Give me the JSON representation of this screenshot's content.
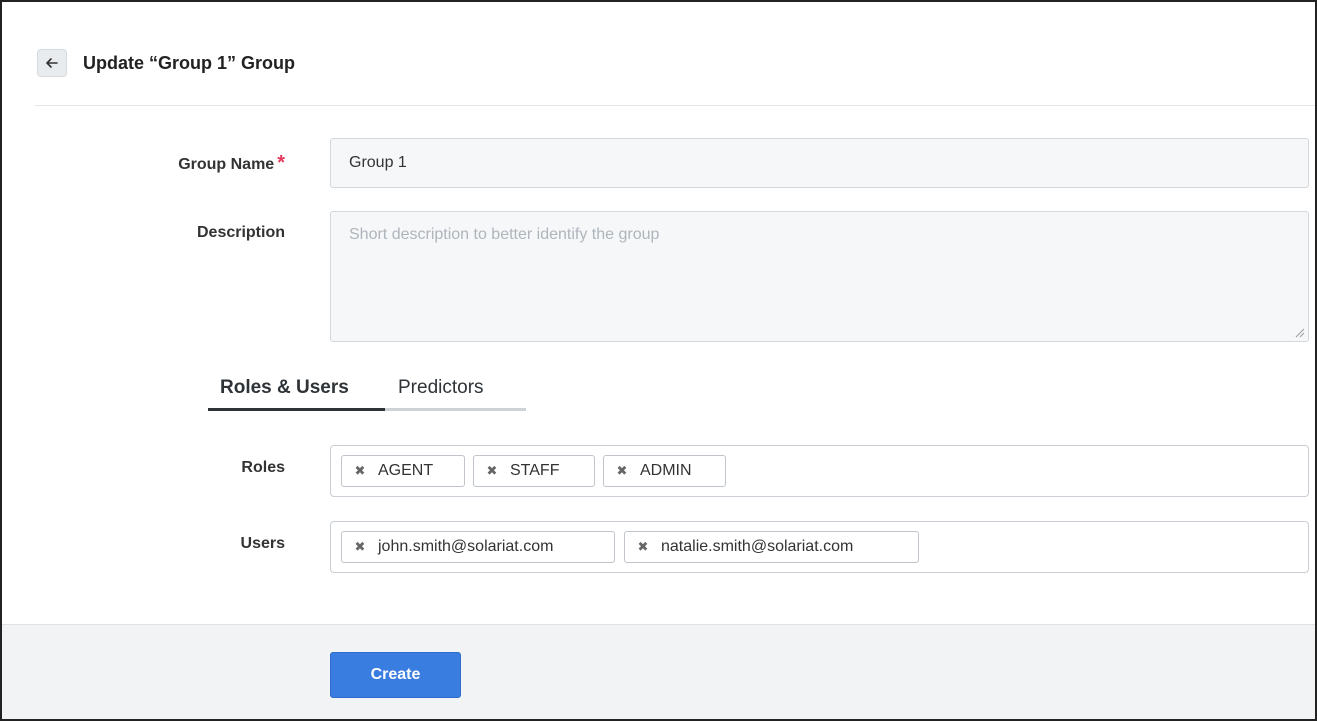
{
  "header": {
    "title": "Update “Group 1” Group",
    "back_icon": "arrow-left-icon"
  },
  "form": {
    "group_name": {
      "label": "Group Name",
      "required_mark": "*",
      "value": "Group 1"
    },
    "description": {
      "label": "Description",
      "value": "",
      "placeholder": "Short description to better identify the group"
    }
  },
  "tabs": [
    {
      "label": "Roles & Users",
      "active": true
    },
    {
      "label": "Predictors",
      "active": false
    }
  ],
  "roles": {
    "label": "Roles",
    "remove_glyph": "✖",
    "items": [
      "AGENT",
      "STAFF",
      "ADMIN"
    ]
  },
  "users": {
    "label": "Users",
    "remove_glyph": "✖",
    "items": [
      "john.smith@solariat.com",
      "natalie.smith@solariat.com"
    ]
  },
  "footer": {
    "create_label": "Create"
  },
  "colors": {
    "accent": "#3a7de0",
    "required": "#e8365d",
    "tab_active": "#2e3338"
  }
}
